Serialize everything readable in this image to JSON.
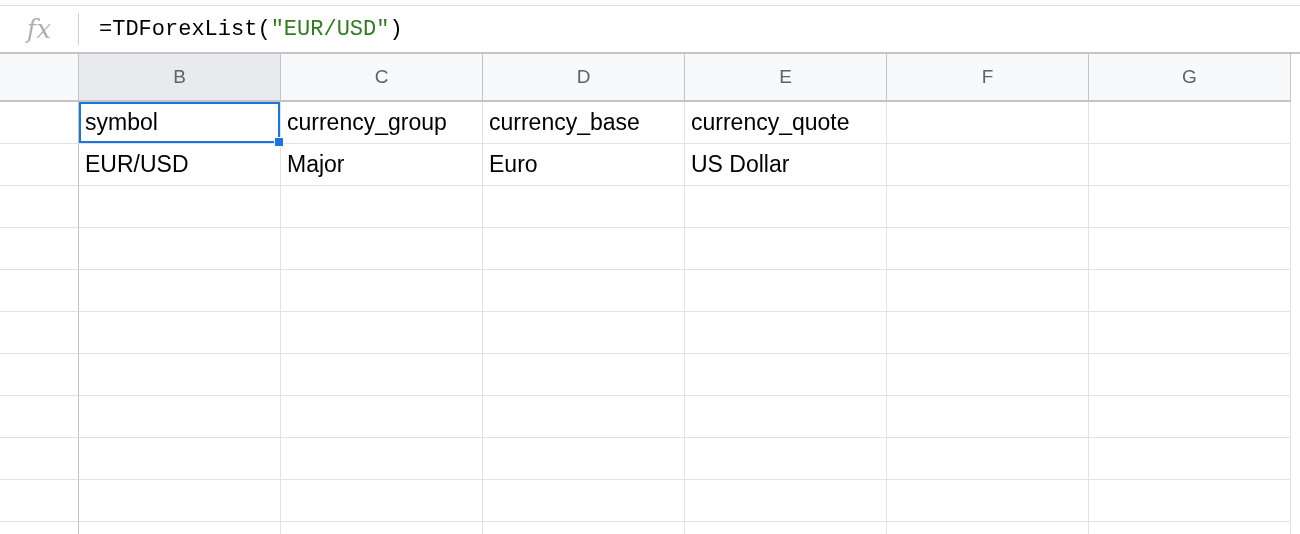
{
  "formula_bar": {
    "icon_text": "fx",
    "formula": [
      {
        "kind": "plain",
        "text": "=TDForexList("
      },
      {
        "kind": "string",
        "text": "\"EUR/USD\""
      },
      {
        "kind": "plain",
        "text": ")"
      }
    ]
  },
  "columns": [
    {
      "label": "B",
      "selected": true
    },
    {
      "label": "C",
      "selected": false
    },
    {
      "label": "D",
      "selected": false
    },
    {
      "label": "E",
      "selected": false
    },
    {
      "label": "F",
      "selected": false
    },
    {
      "label": "G",
      "selected": false
    }
  ],
  "rows": [
    {
      "cells": [
        {
          "text": "symbol",
          "selected": true
        },
        {
          "text": "currency_group",
          "selected": false
        },
        {
          "text": "currency_base",
          "selected": false
        },
        {
          "text": "currency_quote",
          "selected": false
        }
      ]
    },
    {
      "cells": [
        {
          "text": "EUR/USD",
          "selected": false
        },
        {
          "text": "Major",
          "selected": false
        },
        {
          "text": "Euro",
          "selected": false
        },
        {
          "text": "US Dollar",
          "selected": false
        }
      ]
    }
  ]
}
